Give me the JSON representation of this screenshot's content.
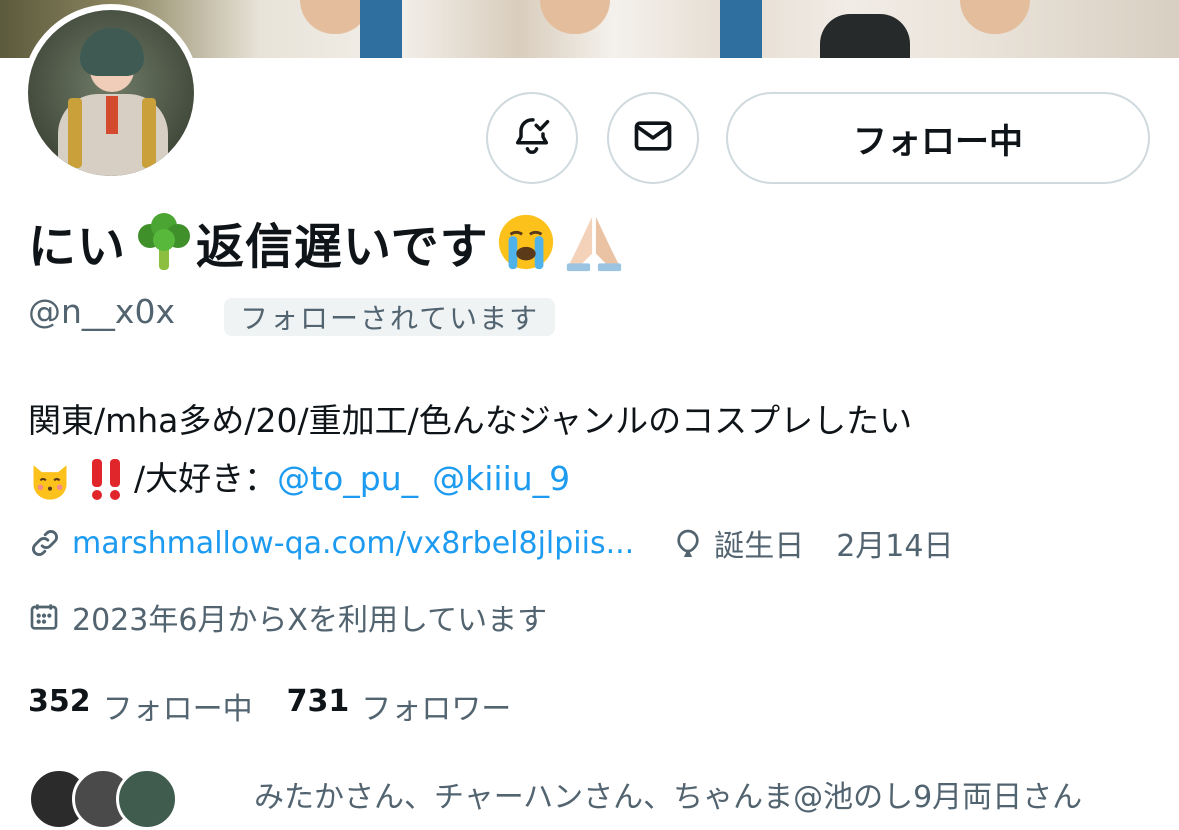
{
  "profile": {
    "display_name": "にい🥦返信遅いです😭🙏🏻",
    "display_name_text": "にい",
    "display_name_text2": "返信遅いです",
    "handle": "@n__x0x",
    "follows_you": "フォローされています",
    "bio_line1": "関東/mha多め/20/重加工/色んなジャンルのコスプレしたい",
    "bio_line2_prefix": "/大好き：",
    "mention1": "@to_pu_",
    "mention2": "@kiiiu_9",
    "website": "marshmallow-qa.com/vx8rbel8jlpiis...",
    "birthday_label": "誕生日",
    "birthday": "2月14日",
    "joined": "2023年6月からXを利用しています"
  },
  "actions": {
    "follow_state_label": "フォロー中"
  },
  "stats": {
    "following_count": "352",
    "following_label": "フォロー中",
    "followers_count": "731",
    "followers_label": "フォロワー"
  },
  "followed_by_text": "みたかさん、チャーハンさん、ちゃんま@池のし9月両日さん",
  "icons": {
    "notify": "bell-check-icon",
    "message": "mail-icon",
    "link": "link-icon",
    "birthday": "balloon-icon",
    "calendar": "calendar-icon"
  },
  "colors": {
    "accent": "#1d9bf0",
    "text": "#0f1419",
    "secondary": "#536471",
    "border": "#cfd9de"
  }
}
